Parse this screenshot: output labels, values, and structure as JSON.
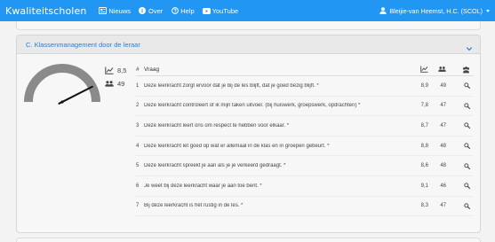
{
  "nav": {
    "brand": "Kwaliteitscholen",
    "links": [
      {
        "label": "Nieuws",
        "icon": "newspaper-icon"
      },
      {
        "label": "Over",
        "icon": "info-icon"
      },
      {
        "label": "Help",
        "icon": "help-icon"
      },
      {
        "label": "YouTube",
        "icon": "youtube-icon"
      }
    ],
    "user": "Bleijie-van Heemst, H.C. (SCOL)"
  },
  "section": {
    "title": "C. Klassenmanagement door de leraar",
    "gauge_score": 0.85,
    "score": "8,5",
    "respondents": "49"
  },
  "table": {
    "header_num": "#",
    "header_question": "Vraag",
    "rows": [
      {
        "num": "1",
        "question": "Deze leerkracht zorgt ervoor dat je bij de les blijft, dat je goed bezig blijft. *",
        "score": "8,9",
        "n": "49"
      },
      {
        "num": "2",
        "question": "Deze leerkracht controleert of ik mijn taken uitvoer. (bij huiswerk, groepswerk, opdrachten) *",
        "score": "7,8",
        "n": "47"
      },
      {
        "num": "3",
        "question": "Deze leerkracht leert ons om respect te hebben voor elkaar. *",
        "score": "8,7",
        "n": "47"
      },
      {
        "num": "4",
        "question": "Deze leerkracht let goed op wat er allemaal in de klas en in groepen gebeurt. *",
        "score": "8,8",
        "n": "48"
      },
      {
        "num": "5",
        "question": "Deze leerkracht spreekt je aan als je je verkeerd gedraagt. *",
        "score": "8,6",
        "n": "48"
      },
      {
        "num": "6",
        "question": "Je weet bij deze leerkracht waar je aan toe bent. *",
        "score": "9,1",
        "n": "46"
      },
      {
        "num": "7",
        "question": "Bij deze leerkracht is het rustig in de les. *",
        "score": "8,3",
        "n": "47"
      }
    ]
  },
  "colors": {
    "navbar": "#2196f3",
    "title": "#2a7ed6",
    "gauge": "#8a8a8a"
  }
}
